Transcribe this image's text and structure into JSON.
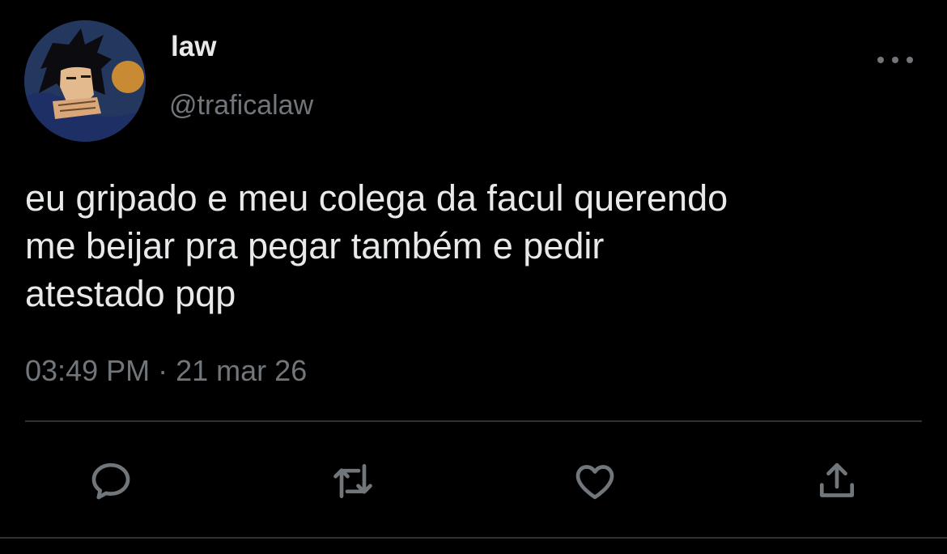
{
  "user": {
    "display_name": "law",
    "handle": "@traficalaw"
  },
  "tweet": {
    "text": "eu gripado e meu colega da facul querendo\nme beijar pra pegar também e pedir\natestado pqp",
    "time": "03:49 PM",
    "separator": "·",
    "date": "21 mar 26"
  },
  "icons": {
    "more": "more-horizontal-icon",
    "reply": "reply-icon",
    "retweet": "retweet-icon",
    "like": "heart-icon",
    "share": "share-icon"
  },
  "colors": {
    "background": "#000000",
    "primary_text": "#e7e9ea",
    "secondary_text": "#71767b",
    "divider": "#2f3336"
  }
}
